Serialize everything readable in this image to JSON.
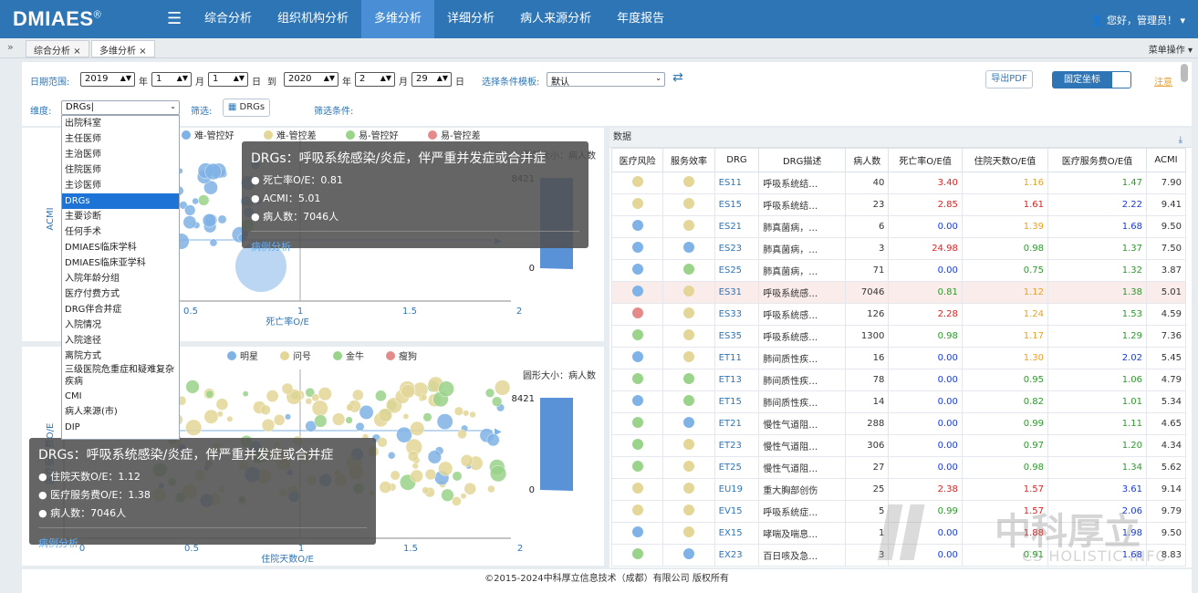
{
  "header": {
    "logo": "DMIAES",
    "logo_mark": "®",
    "nav": [
      "综合分析",
      "组织机构分析",
      "多维分析",
      "详细分析",
      "病人来源分析",
      "年度报告"
    ],
    "active_nav": 2,
    "user": "您好，管理员！"
  },
  "tabs": {
    "items": [
      "综合分析",
      "多维分析"
    ],
    "close": "×",
    "menu": "菜单操作"
  },
  "filters": {
    "date_label": "日期范围:",
    "from_year": "2019",
    "from_month": "1",
    "from_day": "1",
    "to_word": "到",
    "to_year": "2020",
    "to_month": "2",
    "to_day": "29",
    "year": "年",
    "month": "月",
    "day": "日",
    "template_label": "选择条件模板:",
    "template_value": "默认",
    "export": "导出PDF",
    "fixed": "固定坐标",
    "note": "注意",
    "dim_label": "维度:",
    "dim_value": "DRGs",
    "filter_label": "筛选:",
    "filter_btn": "DRGs",
    "cond_label": "筛选条件:"
  },
  "dropdown": {
    "items": [
      "出院科室",
      "主任医师",
      "主治医师",
      "住院医师",
      "主诊医师",
      "DRGs",
      "主要诊断",
      "任何手术",
      "DMIAES临床学科",
      "DMIAES临床亚学科",
      "入院年龄分组",
      "医疗付费方式",
      "DRG伴合并症",
      "入院情况",
      "入院途径",
      "离院方式",
      "三级医院危重症和疑难复杂疾病",
      "CMI",
      "病人来源(市)",
      "DIP"
    ],
    "selected": 5
  },
  "chart1": {
    "legend": [
      "难-管控好",
      "难-管控差",
      "易-管控好",
      "易-管控差"
    ],
    "legend_colors": [
      "#7fb2e6",
      "#e3d697",
      "#9ad38a",
      "#e58a8a"
    ],
    "ylabel": "ACMI",
    "xlabel": "死亡率O/E",
    "xticks": [
      "0.5",
      "1",
      "1.5",
      "2"
    ],
    "size_label": "圆形大小：病人数",
    "scale_max": "8421",
    "scale_min": "0"
  },
  "tooltip1": {
    "title": "DRGs：呼吸系统感染/炎症，伴严重并发症或合并症",
    "rows": [
      "死亡率O/E：0.81",
      "ACMI：5.01",
      "病人数：7046人"
    ],
    "link": "病例分析"
  },
  "chart2": {
    "legend": [
      "明星",
      "问号",
      "金牛",
      "瘦狗"
    ],
    "legend_colors": [
      "#7fb2e6",
      "#e3d697",
      "#9ad38a",
      "#e58a8a"
    ],
    "xlabel": "住院天数O/E",
    "ylabel": "医疗服务费O/E",
    "xticks": [
      "0",
      "0.5",
      "1",
      "1.5",
      "2"
    ],
    "size_label": "圆形大小：病人数",
    "scale_max": "8421",
    "scale_min": "0"
  },
  "tooltip2": {
    "title": "DRGs：呼吸系统感染/炎症，伴严重并发症或合并症",
    "rows": [
      "住院天数O/E：1.12",
      "医疗服务费O/E：1.38",
      "病人数：7046人"
    ],
    "link": "病例分析"
  },
  "table": {
    "title": "数据",
    "headers": [
      "医疗风险",
      "服务效率",
      "DRG",
      "DRG描述",
      "病人数",
      "死亡率O/E值",
      "住院天数O/E值",
      "医疗服务费O/E值",
      "ACMI"
    ],
    "rows": [
      [
        "#e3d697",
        "#e3d697",
        "ES11",
        "呼吸系统结…",
        "40",
        "3.40",
        "1.16",
        "1.47",
        "7.90"
      ],
      [
        "#e3d697",
        "#e3d697",
        "ES15",
        "呼吸系统结…",
        "23",
        "2.85",
        "1.61",
        "2.22",
        "9.41"
      ],
      [
        "#7fb2e6",
        "#e3d697",
        "ES21",
        "肺真菌病，…",
        "6",
        "0.00",
        "1.39",
        "1.68",
        "9.50"
      ],
      [
        "#7fb2e6",
        "#7fb2e6",
        "ES23",
        "肺真菌病，…",
        "3",
        "24.98",
        "0.98",
        "1.37",
        "7.50"
      ],
      [
        "#7fb2e6",
        "#9ad38a",
        "ES25",
        "肺真菌病，…",
        "71",
        "0.00",
        "0.75",
        "1.32",
        "3.87"
      ],
      [
        "#7fb2e6",
        "#e3d697",
        "ES31",
        "呼吸系统感…",
        "7046",
        "0.81",
        "1.12",
        "1.38",
        "5.01"
      ],
      [
        "#e58a8a",
        "#e3d697",
        "ES33",
        "呼吸系统感…",
        "126",
        "2.28",
        "1.24",
        "1.53",
        "4.59"
      ],
      [
        "#9ad38a",
        "#e3d697",
        "ES35",
        "呼吸系统感…",
        "1300",
        "0.98",
        "1.17",
        "1.29",
        "7.36"
      ],
      [
        "#7fb2e6",
        "#e3d697",
        "ET11",
        "肺间质性疾…",
        "16",
        "0.00",
        "1.30",
        "2.02",
        "5.45"
      ],
      [
        "#9ad38a",
        "#9ad38a",
        "ET13",
        "肺间质性疾…",
        "78",
        "0.00",
        "0.95",
        "1.06",
        "4.79"
      ],
      [
        "#7fb2e6",
        "#9ad38a",
        "ET15",
        "肺间质性疾…",
        "14",
        "0.00",
        "0.82",
        "1.01",
        "5.34"
      ],
      [
        "#9ad38a",
        "#7fb2e6",
        "ET21",
        "慢性气道阻…",
        "288",
        "0.00",
        "0.99",
        "1.11",
        "4.65"
      ],
      [
        "#9ad38a",
        "#e3d697",
        "ET23",
        "慢性气道阻…",
        "306",
        "0.00",
        "0.97",
        "1.20",
        "4.34"
      ],
      [
        "#9ad38a",
        "#e3d697",
        "ET25",
        "慢性气道阻…",
        "27",
        "0.00",
        "0.98",
        "1.34",
        "5.62"
      ],
      [
        "#e3d697",
        "#e3d697",
        "EU19",
        "重大胸部创伤",
        "25",
        "2.38",
        "1.57",
        "3.61",
        "9.14"
      ],
      [
        "#e3d697",
        "#e3d697",
        "EV15",
        "呼吸系统症…",
        "5",
        "0.99",
        "1.57",
        "2.06",
        "9.79"
      ],
      [
        "#7fb2e6",
        "#e3d697",
        "EX15",
        "哮喘及喘息…",
        "1",
        "0.00",
        "1.88",
        "1.98",
        "9.50"
      ],
      [
        "#9ad38a",
        "#7fb2e6",
        "EX23",
        "百日咳及急…",
        "3",
        "0.00",
        "0.91",
        "1.68",
        "8.83"
      ]
    ]
  },
  "watermark": {
    "cn": "中科厚立",
    "en": "CS HOLISTIC INFO"
  },
  "footer": "©2015-2024中科厚立信息技术（成都）有限公司 版权所有"
}
